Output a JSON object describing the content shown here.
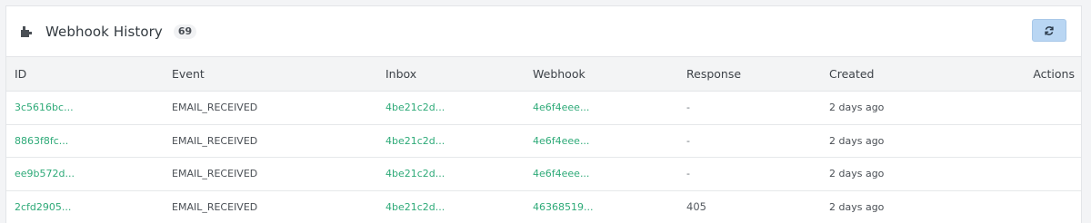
{
  "header": {
    "title": "Webhook History",
    "count": "69"
  },
  "table": {
    "columns": [
      "ID",
      "Event",
      "Inbox",
      "Webhook",
      "Response",
      "Created",
      "Actions"
    ],
    "rows": [
      {
        "id": "3c5616bc...",
        "event": "EMAIL_RECEIVED",
        "inbox": "4be21c2d...",
        "webhook": "4e6f4eee...",
        "response": "-",
        "created": "2 days ago"
      },
      {
        "id": "8863f8fc...",
        "event": "EMAIL_RECEIVED",
        "inbox": "4be21c2d...",
        "webhook": "4e6f4eee...",
        "response": "-",
        "created": "2 days ago"
      },
      {
        "id": "ee9b572d...",
        "event": "EMAIL_RECEIVED",
        "inbox": "4be21c2d...",
        "webhook": "4e6f4eee...",
        "response": "-",
        "created": "2 days ago"
      },
      {
        "id": "2cfd2905...",
        "event": "EMAIL_RECEIVED",
        "inbox": "4be21c2d...",
        "webhook": "46368519...",
        "response": "405",
        "created": "2 days ago"
      }
    ]
  },
  "icons": {
    "header_icon": "plugin-icon",
    "refresh": "refresh-icon"
  },
  "colors": {
    "link": "#2eaa78",
    "refresh_button": "#b9d6f3"
  }
}
